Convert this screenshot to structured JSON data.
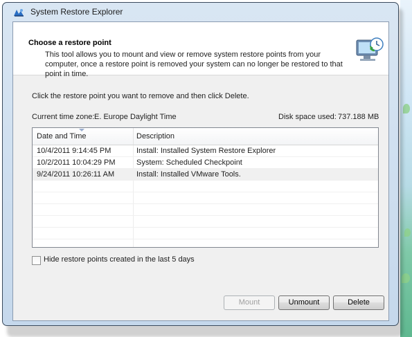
{
  "window": {
    "title": "System Restore Explorer"
  },
  "header": {
    "heading": "Choose a restore point",
    "description": "This tool allows you to mount and view or remove system restore points from your computer, once a restore point is removed your system can no longer be restored to that point in time.",
    "icon": "computer-restore-icon"
  },
  "instruction": "Click the restore point you want to remove and then click Delete.",
  "timezone": {
    "label": "Current time zone:",
    "value": "E. Europe Daylight Time"
  },
  "disk": {
    "label": "Disk space used:",
    "value": "737.188 MB"
  },
  "list": {
    "columns": [
      "Date and Time",
      "Description"
    ],
    "rows": [
      {
        "date": "10/4/2011 9:14:45 PM",
        "description": "Install: Installed System Restore Explorer"
      },
      {
        "date": "10/2/2011 10:04:29 PM",
        "description": "System: Scheduled Checkpoint"
      },
      {
        "date": "9/24/2011 10:26:11 AM",
        "description": "Install: Installed VMware Tools."
      }
    ]
  },
  "options": {
    "hide_recent": {
      "label": "Hide restore points created in the last 5 days",
      "checked": false
    }
  },
  "buttons": {
    "mount": "Mount",
    "unmount": "Unmount",
    "delete": "Delete"
  }
}
